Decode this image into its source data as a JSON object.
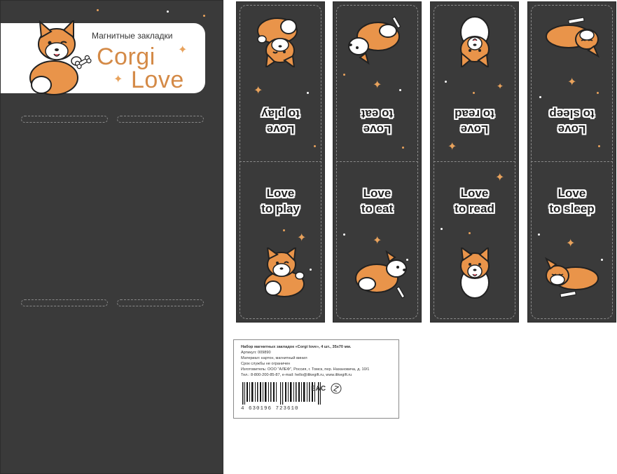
{
  "holder": {
    "subtitle": "Магнитные закладки",
    "title_line1": "Corgi",
    "title_line2": "Love"
  },
  "bookmarks": [
    {
      "line1": "Love",
      "line2": "to play"
    },
    {
      "line1": "Love",
      "line2": "to eat"
    },
    {
      "line1": "Love",
      "line2": "to read"
    },
    {
      "line1": "Love",
      "line2": "to sleep"
    }
  ],
  "label": {
    "product": "Набор магнитных закладок «Corgi love», 4 шт., 35х70 мм.",
    "article": "Артикул: 009890",
    "material": "Материал: картон, магнитный винил",
    "shelf_life": "Срок службы не ограничен",
    "manufacturer": "Изготовитель: ООО \"АЛЕФ\", Россия, г. Томск, пер. Нахановича, д. 10/1",
    "contacts": "Тел.: 8-800-200-85-87, e-mail: hello@ilikegift.ru, www.ilikegift.ru",
    "barcode_digits": "4 630196 723610",
    "eac_mark": "EAC"
  },
  "colors": {
    "background_dark": "#3a3a3a",
    "accent_orange": "#e8a25c",
    "title_orange": "#d48a47",
    "corgi_orange": "#e9944a"
  },
  "icons": [
    "corgi-illustration-icon",
    "sparkle-icon",
    "bone-icon",
    "eac-mark-icon",
    "recycle-icon",
    "barcode-icon"
  ]
}
